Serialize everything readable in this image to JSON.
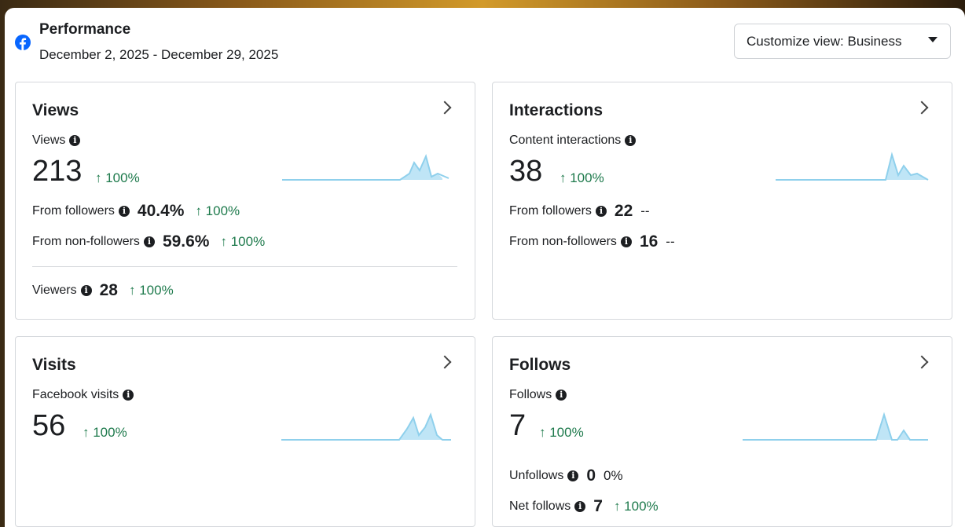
{
  "header": {
    "title": "Performance",
    "date_range": "December 2, 2025 - December 29, 2025",
    "customize_label": "Customize view: Business"
  },
  "colors": {
    "positive": "#1e7a4c",
    "sparkline": "#8fd0ec",
    "sparkline_fill": "#bfe5f6"
  },
  "cards": {
    "views": {
      "title": "Views",
      "metric_label": "Views",
      "value": "213",
      "change": "↑ 100%",
      "from_followers_label": "From followers",
      "from_followers_value": "40.4%",
      "from_followers_change": "↑ 100%",
      "from_non_followers_label": "From non-followers",
      "from_non_followers_value": "59.6%",
      "from_non_followers_change": "↑ 100%",
      "viewers_label": "Viewers",
      "viewers_value": "28",
      "viewers_change": "↑ 100%"
    },
    "interactions": {
      "title": "Interactions",
      "metric_label": "Content interactions",
      "value": "38",
      "change": "↑ 100%",
      "from_followers_label": "From followers",
      "from_followers_value": "22",
      "from_followers_change": "--",
      "from_non_followers_label": "From non-followers",
      "from_non_followers_value": "16",
      "from_non_followers_change": "--"
    },
    "visits": {
      "title": "Visits",
      "metric_label": "Facebook visits",
      "value": "56",
      "change": "↑ 100%"
    },
    "follows": {
      "title": "Follows",
      "metric_label": "Follows",
      "value": "7",
      "change": "↑ 100%",
      "unfollows_label": "Unfollows",
      "unfollows_value": "0",
      "unfollows_change": "0%",
      "net_follows_label": "Net follows",
      "net_follows_value": "7",
      "net_follows_change": "↑ 100%"
    }
  },
  "icons": {
    "logo": "facebook-logo-icon",
    "info": "info-icon",
    "chevron": "chevron-right-icon",
    "caret": "caret-down-icon"
  }
}
